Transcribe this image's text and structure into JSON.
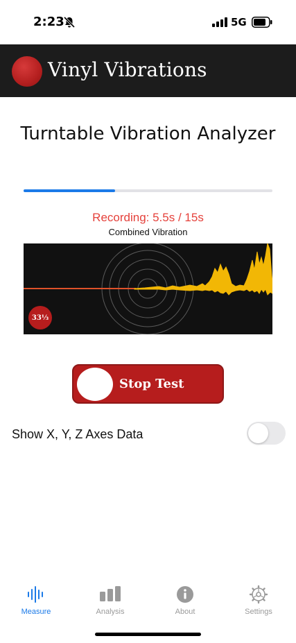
{
  "status_bar": {
    "time": "2:23",
    "network": "5G",
    "icons": [
      "bell-slash-icon",
      "signal-bars-icon",
      "battery-icon"
    ]
  },
  "header": {
    "title": "Vinyl Vibrations",
    "logo_icon": "record-logo-icon"
  },
  "page": {
    "title": "Turntable Vibration Analyzer"
  },
  "recording": {
    "progress": 0.367,
    "status": "Recording: 5.5s / 15s",
    "graph_label": "Combined Vibration",
    "rpm_badge": "33⅓"
  },
  "actions": {
    "stop_label": "Stop Test"
  },
  "options": {
    "axes_toggle_label": "Show X, Y, Z Axes Data",
    "axes_toggle_on": false
  },
  "tabs": [
    {
      "label": "Measure",
      "icon": "waveform-icon",
      "active": true
    },
    {
      "label": "Analysis",
      "icon": "bar-chart-icon",
      "active": false
    },
    {
      "label": "About",
      "icon": "info-icon",
      "active": false
    },
    {
      "label": "Settings",
      "icon": "gear-icon",
      "active": false
    }
  ],
  "colors": {
    "accent": "#1b7ae8",
    "brand_red": "#b61d1d",
    "recording_text": "#e5413b",
    "header_bg": "#1c1c1c",
    "waveform_baseline": "#e0522a",
    "waveform_signal": "#f2b705"
  }
}
